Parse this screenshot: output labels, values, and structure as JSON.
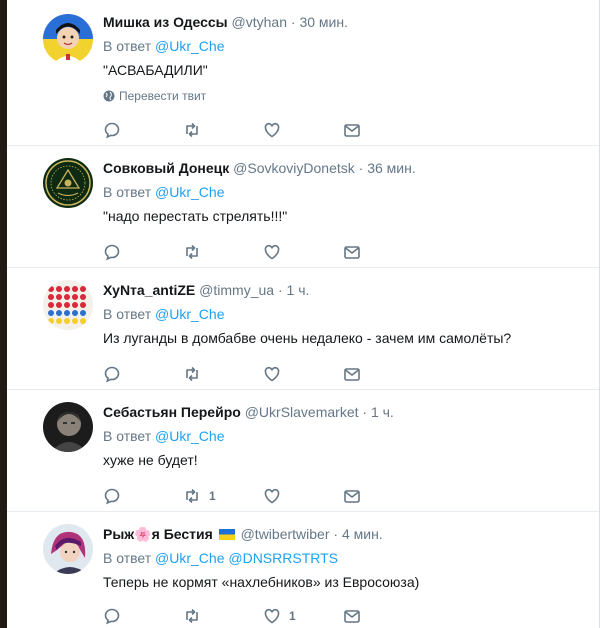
{
  "tweets": [
    {
      "name": "Мишка из Одессы",
      "handle": "@vtyhan",
      "time": "30 мин.",
      "reply_label": "В ответ",
      "mentions": "@Ukr_Che",
      "text": "\"АСВАБАДИЛИ\"",
      "translate_label": "Перевести твит",
      "retweets": "",
      "likes": ""
    },
    {
      "name": "Совковый Донецк",
      "handle": "@SovkoviyDonetsk",
      "time": "36 мин.",
      "reply_label": "В ответ",
      "mentions": "@Ukr_Che",
      "text": "\"надо перестать стрелять!!!\"",
      "retweets": "",
      "likes": ""
    },
    {
      "name": "ХуNта_antiZE",
      "handle": "@timmy_ua",
      "time": "1 ч.",
      "reply_label": "В ответ",
      "mentions": "@Ukr_Che",
      "text": "Из луганды в домбабве очень недалеко - зачем им самолёты?",
      "retweets": "",
      "likes": ""
    },
    {
      "name": "Себастьян Перейро",
      "handle": "@UkrSlavemarket",
      "time": "1 ч.",
      "reply_label": "В ответ",
      "mentions": "@Ukr_Che",
      "text": "хуже не будет!",
      "retweets": "1",
      "likes": ""
    },
    {
      "name_part1": "Рыж",
      "name_emoji": "🌸",
      "name_part2": "я Бестия",
      "handle": "@twibertwiber",
      "time": "4 мин.",
      "reply_label": "В ответ",
      "mentions": "@Ukr_Che @DNSRRSTRTS",
      "text": "Теперь не кормят «нахлебников» из Евросоюза)",
      "retweets": "",
      "likes": "1"
    }
  ],
  "separator": "·",
  "colors": {
    "link": "#1da1f2",
    "muted": "#657786",
    "text": "#14171a",
    "border": "#e6ecf0"
  },
  "icons": [
    "reply-icon",
    "retweet-icon",
    "like-icon",
    "dm-icon",
    "globe-icon",
    "ukraine-flag-icon"
  ]
}
